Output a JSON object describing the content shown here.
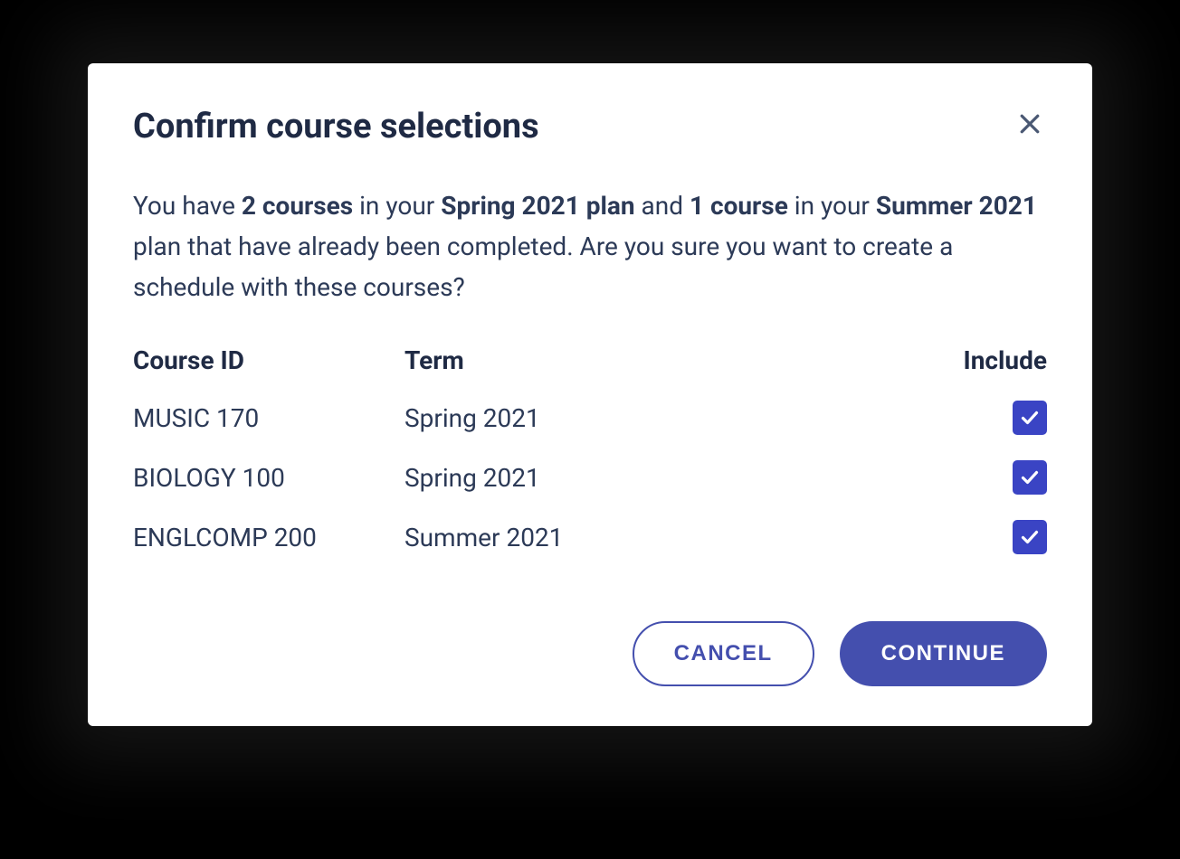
{
  "dialog": {
    "title": "Confirm course selections",
    "description": {
      "pre1": "You have ",
      "b1": "2 courses",
      "mid1": " in your ",
      "b2": "Spring 2021 plan",
      "mid2": " and ",
      "b3": "1 course",
      "mid3": " in your ",
      "b4": "Summer 2021",
      "post": " plan that have already been completed. Are you sure you want to create a schedule with these courses?"
    },
    "columns": {
      "course_id": "Course ID",
      "term": "Term",
      "include": "Include"
    },
    "rows": [
      {
        "course_id": "MUSIC 170",
        "term": "Spring 2021",
        "include": true
      },
      {
        "course_id": "BIOLOGY 100",
        "term": "Spring 2021",
        "include": true
      },
      {
        "course_id": "ENGLCOMP 200",
        "term": "Summer 2021",
        "include": true
      }
    ],
    "actions": {
      "cancel": "CANCEL",
      "continue": "CONTINUE"
    }
  }
}
